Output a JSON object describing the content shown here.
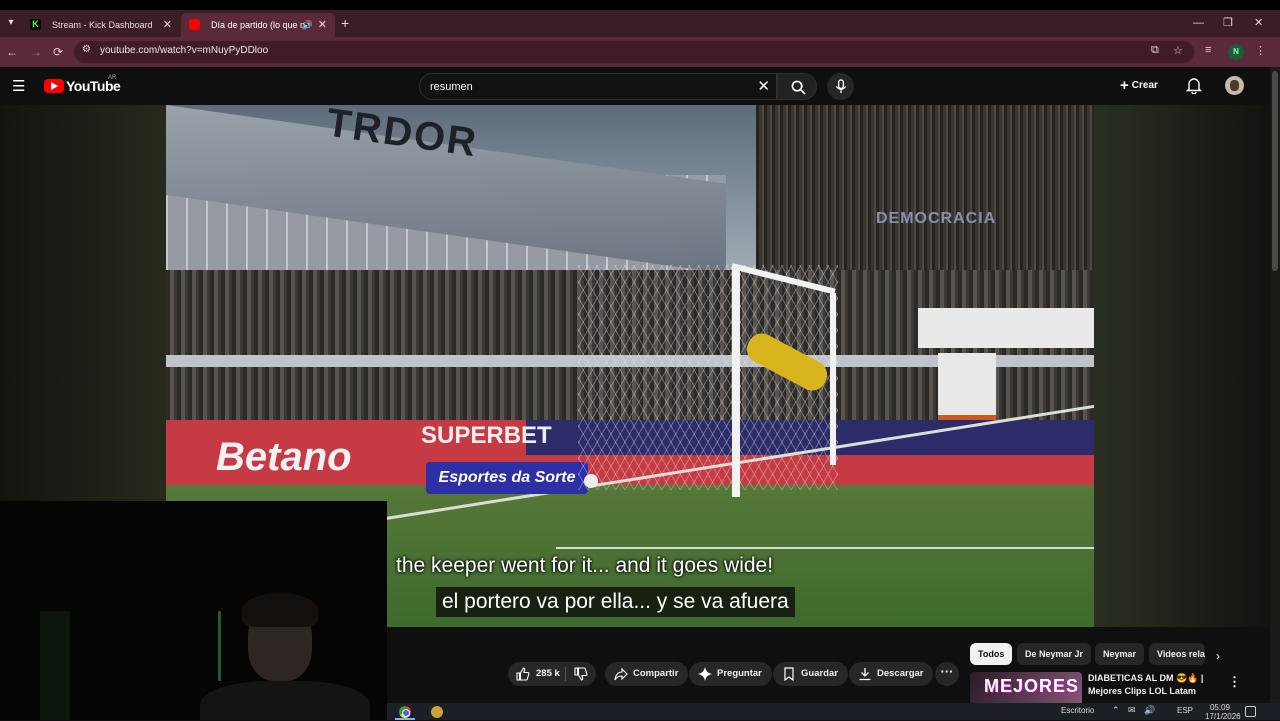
{
  "browser": {
    "tabs": [
      {
        "title": "Stream - Kick Dashboard",
        "favicon": "kick-icon",
        "favicon_color": "#53fc18"
      },
      {
        "title": "Día de partido (lo que no ve",
        "favicon": "youtube-icon",
        "favicon_color": "#ff0000",
        "audio": true
      }
    ],
    "url": "youtube.com/watch?v=mNuyPyDDloo",
    "profile_initial": "N",
    "accent": "#5b2a3a"
  },
  "youtube": {
    "logo_text": "YouTube",
    "country_code": "AR",
    "search_query": "resumen",
    "create_label": "Crear"
  },
  "video": {
    "scene_text": {
      "roof_sign": "TRDOR",
      "banner": "DEMOCRACIA",
      "ad_betano": "Betano",
      "ad_superbet": "SUPERBET",
      "ad_sorte": "Esportes da Sorte"
    },
    "subtitle_en": "the keeper went for it... and it goes wide!",
    "subtitle_es": "el portero va por ella... y se va afuera"
  },
  "actions": {
    "likes": "285 k",
    "share": "Compartir",
    "ask": "Preguntar",
    "save": "Guardar",
    "download": "Descargar"
  },
  "chips": [
    "Todos",
    "De Neymar Jr",
    "Neymar",
    "Videos rela"
  ],
  "related": {
    "thumb_text": "MEJORES",
    "title": "DIABETICAS AL DM 😎🔥 | Mejores Clips LOL Latam"
  },
  "taskbar": {
    "desktop_label": "Escritorio",
    "lang": "ESP",
    "time": "05:09",
    "date": "17/1/2026"
  }
}
